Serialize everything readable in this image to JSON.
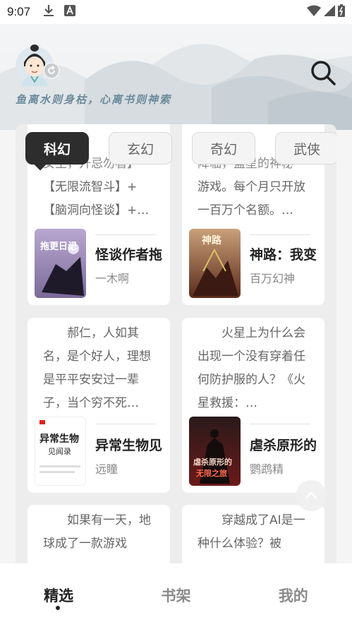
{
  "status": {
    "time": "9:07",
    "icons_left": [
      "download-icon",
      "a-notification-icon"
    ],
    "icons_right": [
      "wifi-icon",
      "signal-icon",
      "battery-icon"
    ]
  },
  "header": {
    "slogan": "鱼离水则身枯，心离书则神索",
    "icons": [
      "avatar-icon",
      "refresh-icon",
      "search-icon"
    ]
  },
  "tabs": [
    {
      "label": "科幻",
      "active": true
    },
    {
      "label": "玄幻",
      "active": false
    },
    {
      "label": "奇幻",
      "active": false
    },
    {
      "label": "武侠",
      "active": false
    }
  ],
  "books": [
    {
      "desc_partial": "女主，升忌勿看】",
      "desc": "【无限流智斗】+【脑洞向怪谈】+…",
      "title": "怪谈作者拖",
      "author": "一木啊",
      "cover_text": "拖更日记",
      "cover_color": "#9b86b8"
    },
    {
      "desc_partial": "降临，蓝星的神秘",
      "desc": "游戏。每个月只开放一百万个名额。…",
      "title": "神路：我变",
      "author": "百万幻神",
      "cover_text": "神路",
      "cover_color": "#8a3a2a"
    },
    {
      "desc": "郝仁，人如其名，是个好人，理想是平平安安过一辈子，当个穷不死…",
      "title": "异常生物见",
      "author": "远瞳",
      "cover_text": "异常生物",
      "cover_subtitle": "见闻录",
      "cover_color": "#ffffff"
    },
    {
      "desc": "火星上为什么会出现一个没有穿着任何防护服的人？《火星救援：…",
      "title": "虐杀原形的",
      "author": "鹦鹉精",
      "cover_text": "虐杀原形的",
      "cover_subtitle": "无限之旅",
      "cover_color": "#5a1e1e"
    },
    {
      "desc": "如果有一天，地球成了一款游戏",
      "title": "",
      "author": ""
    },
    {
      "desc": "穿越成了AI是一种什么体验？被",
      "title": "",
      "author": ""
    }
  ],
  "bottom_nav": [
    {
      "label": "精选",
      "active": true
    },
    {
      "label": "书架",
      "active": false
    },
    {
      "label": "我的",
      "active": false
    }
  ]
}
